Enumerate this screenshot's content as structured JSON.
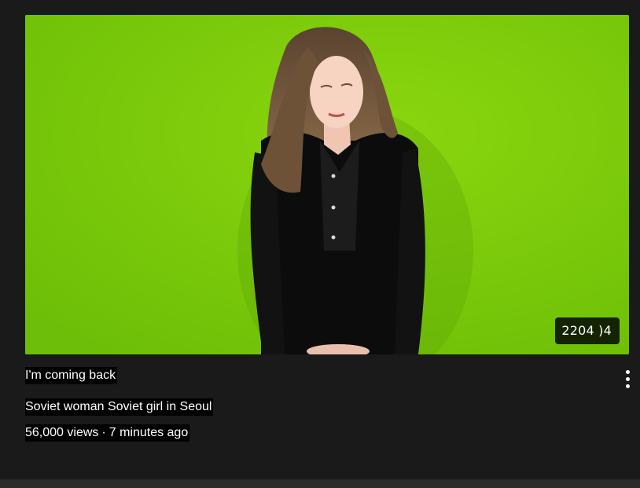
{
  "video": {
    "title": "I'm coming back",
    "channel": "Soviet woman Soviet girl in Seoul",
    "views": "56,000 views",
    "separator": "·",
    "age": "7 minutes ago",
    "duration": "2204 )4",
    "thumbnail_icon": "thumbnail-image-icon",
    "menu_icon": "more-vert-icon"
  },
  "colors": {
    "page_background": "#1a1a1a",
    "thumbnail_background": "#7fcf0c",
    "text": "#ffffff",
    "label_background": "#000000"
  }
}
